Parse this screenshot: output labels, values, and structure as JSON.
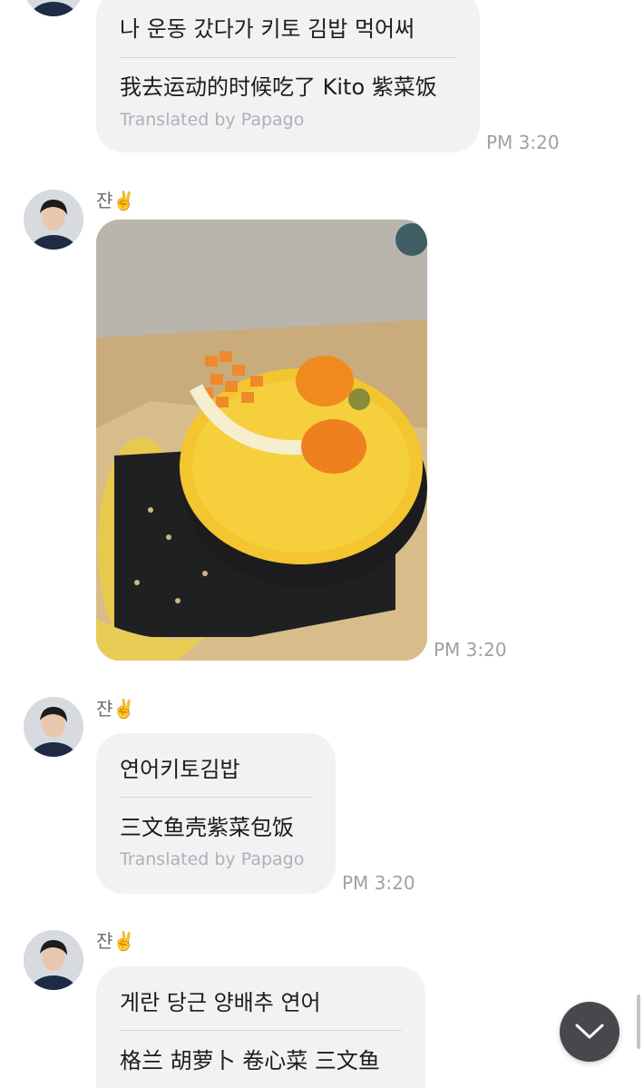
{
  "messages": [
    {
      "original": "나 운동 갔다가 키토 김밥 먹어써",
      "translation": "我去运动的时候吃了 Kito 紫菜饭",
      "translated_by": "Translated by Papago",
      "time": "PM 3:20"
    },
    {
      "sender": "쟌✌️",
      "photo_alt": "photo of salmon keto kimbap",
      "time": "PM 3:20"
    },
    {
      "sender": "쟌✌️",
      "original": "연어키토김밥",
      "translation": "三文鱼壳紫菜包饭",
      "translated_by": "Translated by Papago",
      "time": "PM 3:20"
    },
    {
      "sender": "쟌✌️",
      "original": "게란 당근 양배추 연어",
      "translation": "格兰 胡萝卜 卷心菜 三文鱼"
    }
  ],
  "controls": {
    "scroll_down_icon": "chevron-down-icon"
  },
  "colors": {
    "bubble": "#f2f2f4",
    "text": "#1c1c1e",
    "meta": "#a0a0a6",
    "scroll_button": "#47474e"
  }
}
